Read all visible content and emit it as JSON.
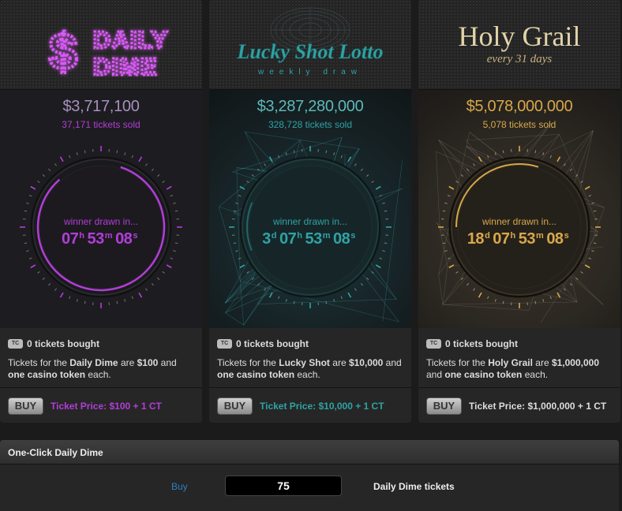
{
  "colors": {
    "daily": "#b23ed8",
    "lucky": "#2fa3a5",
    "holy": "#d8a84a"
  },
  "lotteries": [
    {
      "logo_line1": "DAILY",
      "logo_line2": "DIME",
      "logo_symbol": "$",
      "jackpot": "$3,717,100",
      "sold": "37,171 tickets sold",
      "drawn_label": "winner drawn in...",
      "timer": {
        "d": "",
        "h": "07",
        "m": "53",
        "s": "08"
      },
      "bought": "0 tickets bought",
      "tc_label": "TC",
      "desc_a": "Tickets for the ",
      "desc_name": "Daily Dime",
      "desc_b": " are ",
      "desc_price": "$100",
      "desc_c": " and ",
      "desc_token": "one casino token",
      "desc_d": " each.",
      "buy_label": "BUY",
      "ticket_price": "Ticket Price: $100 + 1 CT"
    },
    {
      "logo_line1": "Lucky Shot Lotto",
      "logo_line2": "weekly draw",
      "jackpot": "$3,287,280,000",
      "sold": "328,728 tickets sold",
      "drawn_label": "winner drawn in...",
      "timer": {
        "d": "3",
        "h": "07",
        "m": "53",
        "s": "08"
      },
      "bought": "0 tickets bought",
      "tc_label": "TC",
      "desc_a": "Tickets for the ",
      "desc_name": "Lucky Shot",
      "desc_b": " are ",
      "desc_price": "$10,000",
      "desc_c": " and ",
      "desc_token": "one casino token",
      "desc_d": " each.",
      "buy_label": "BUY",
      "ticket_price": "Ticket Price: $10,000 + 1 CT"
    },
    {
      "logo_line1": "Holy Grail",
      "logo_line2": "every 31 days",
      "jackpot": "$5,078,000,000",
      "sold": "5,078 tickets sold",
      "drawn_label": "winner drawn in...",
      "timer": {
        "d": "18",
        "h": "07",
        "m": "53",
        "s": "08"
      },
      "bought": "0 tickets bought",
      "tc_label": "TC",
      "desc_a": "Tickets for the ",
      "desc_name": "Holy Grail",
      "desc_b": " are ",
      "desc_price": "$1,000,000",
      "desc_c": " and ",
      "desc_token": "one casino token",
      "desc_d": " each.",
      "buy_label": "BUY",
      "ticket_price": "Ticket Price: $1,000,000 + 1 CT"
    }
  ],
  "units": {
    "d": "d",
    "h": "h",
    "m": "m",
    "s": "s"
  },
  "oneclick": {
    "title": "One-Click Daily Dime",
    "buy_label": "Buy",
    "quantity": "75",
    "unit_label": "Daily Dime tickets"
  }
}
